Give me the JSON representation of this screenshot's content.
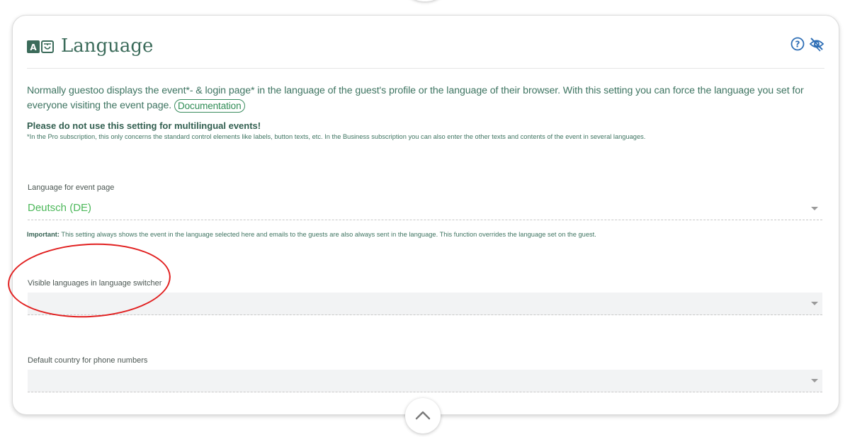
{
  "section": {
    "title": "Language",
    "icons": {
      "section_icon": "language-icon",
      "help": "help-circle-icon",
      "visibility": "eye-off-icon"
    },
    "accent_color": "#3f6e5d"
  },
  "intro": {
    "text": "Normally guestoo displays the event*- & login page* in the language of the guest's profile or the language of their browser. With this setting you can force the language you set for everyone visiting the event page.",
    "doc_link_label": "Documentation"
  },
  "warning": {
    "title": "Please do not use this setting for multilingual events!",
    "note": "*In the Pro subscription, this only concerns the standard control elements like labels, button texts, etc. In the Business subscription you can also enter the other texts and contents of the event in several languages."
  },
  "fields": {
    "event_language": {
      "label": "Language for event page",
      "value": "Deutsch (DE)"
    },
    "important_prefix": "Important:",
    "important_text": "This setting always shows the event in the language selected here and emails to the guests are also always sent in the language. This function overrides the language set on the guest.",
    "visible_languages": {
      "label": "Visible languages in language switcher",
      "value": ""
    },
    "phone_country": {
      "label": "Default country for phone numbers",
      "value": ""
    }
  },
  "footer": {
    "collapse_icon": "chevron-up-icon"
  },
  "highlight_color": "#e11f1f"
}
